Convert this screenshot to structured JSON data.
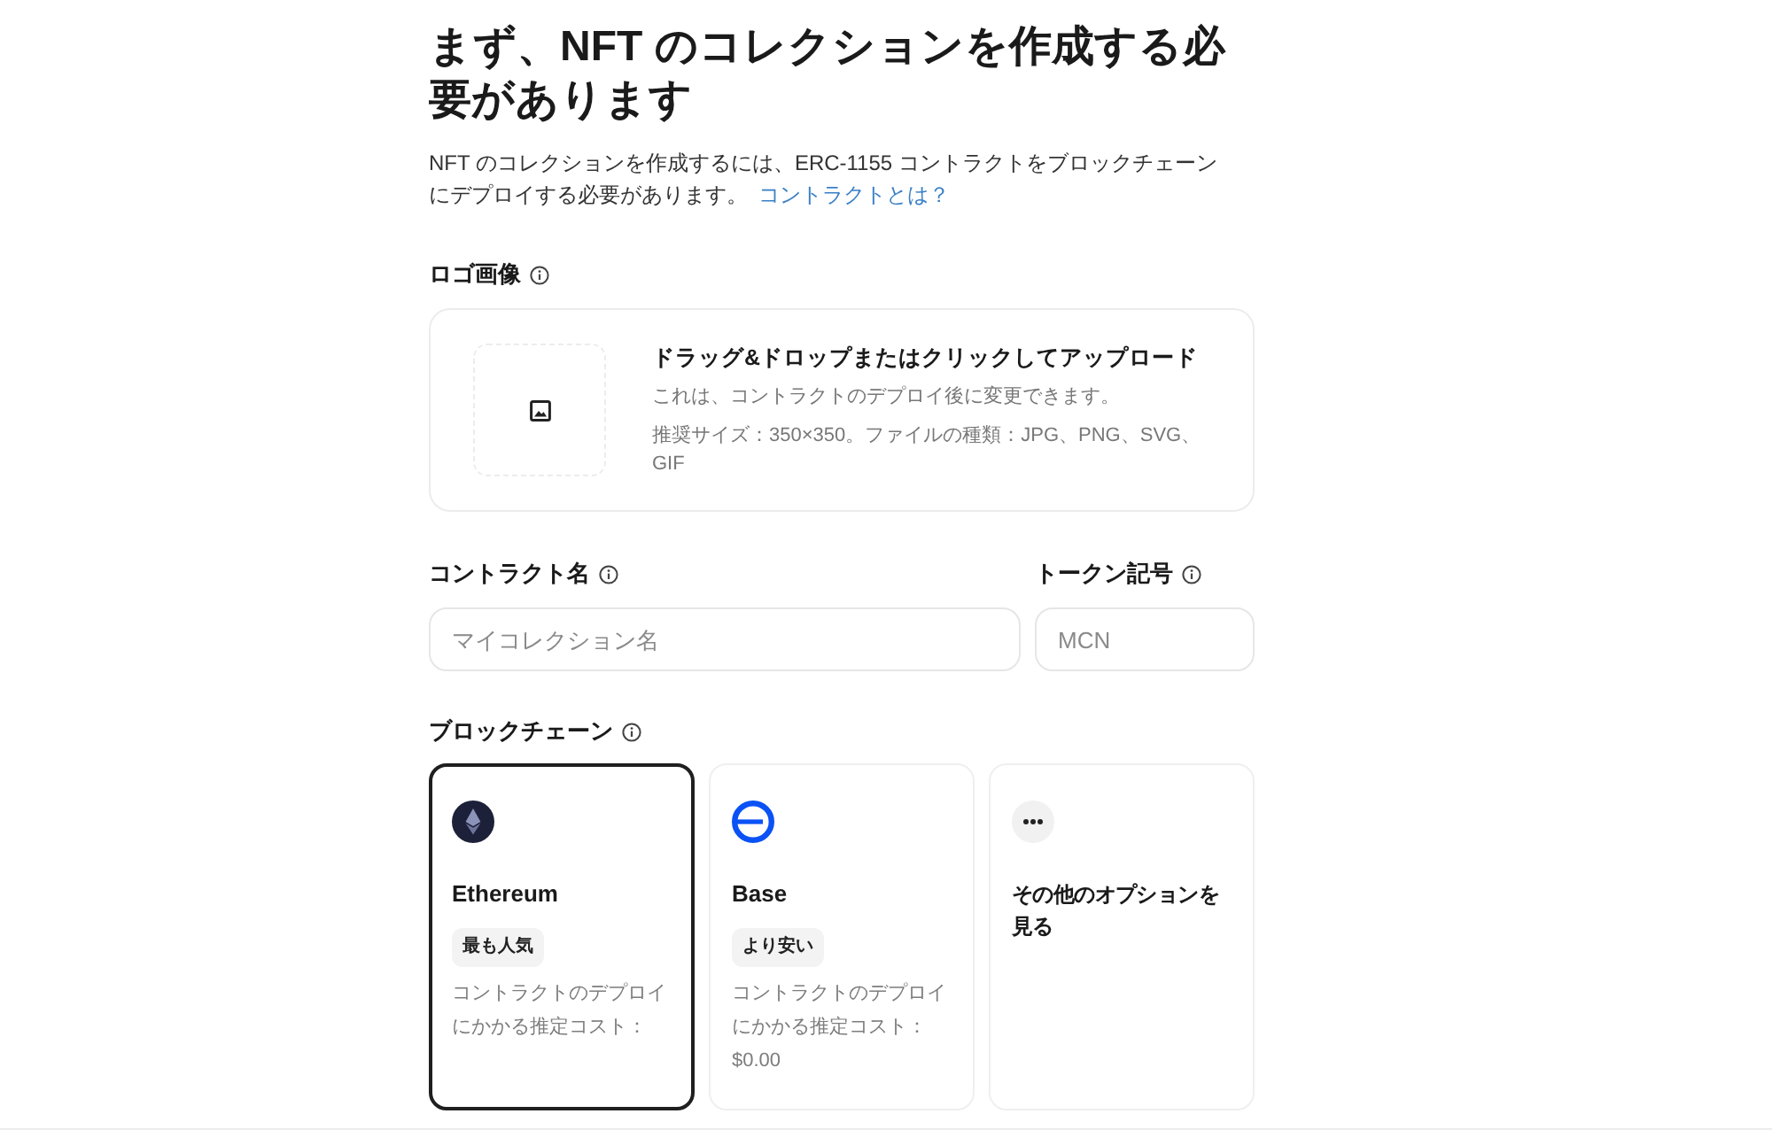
{
  "heading": "まず、NFT のコレクションを作成する必要があります",
  "intro": {
    "text": "NFT のコレクションを作成するには、ERC-1155 コントラクトをブロックチェーンにデプロイする必要があります。",
    "link": "コントラクトとは？"
  },
  "logo_section": {
    "label": "ロゴ画像",
    "upload": {
      "title": "ドラッグ&ドロップまたはクリックしてアップロード",
      "note": "これは、コントラクトのデプロイ後に変更できます。",
      "requirements": "推奨サイズ：350×350。ファイルの種類：JPG、PNG、SVG、GIF"
    }
  },
  "fields": [
    {
      "label": "コントラクト名",
      "placeholder": "マイコレクション名"
    },
    {
      "label": "トークン記号",
      "placeholder": "MCN"
    }
  ],
  "blockchain": {
    "label": "ブロックチェーン",
    "options": [
      {
        "kind": "ethereum",
        "name": "Ethereum",
        "badge": "最も人気",
        "cost_text": "コントラクトのデプロイにかかる推定コスト：",
        "selected": true
      },
      {
        "kind": "base",
        "name": "Base",
        "badge": "より安い",
        "cost_text": "コントラクトのデプロイにかかる推定コスト：",
        "cost": "$0.00",
        "selected": false
      },
      {
        "kind": "more",
        "name": "その他のオプションを見る",
        "selected": false
      }
    ]
  }
}
